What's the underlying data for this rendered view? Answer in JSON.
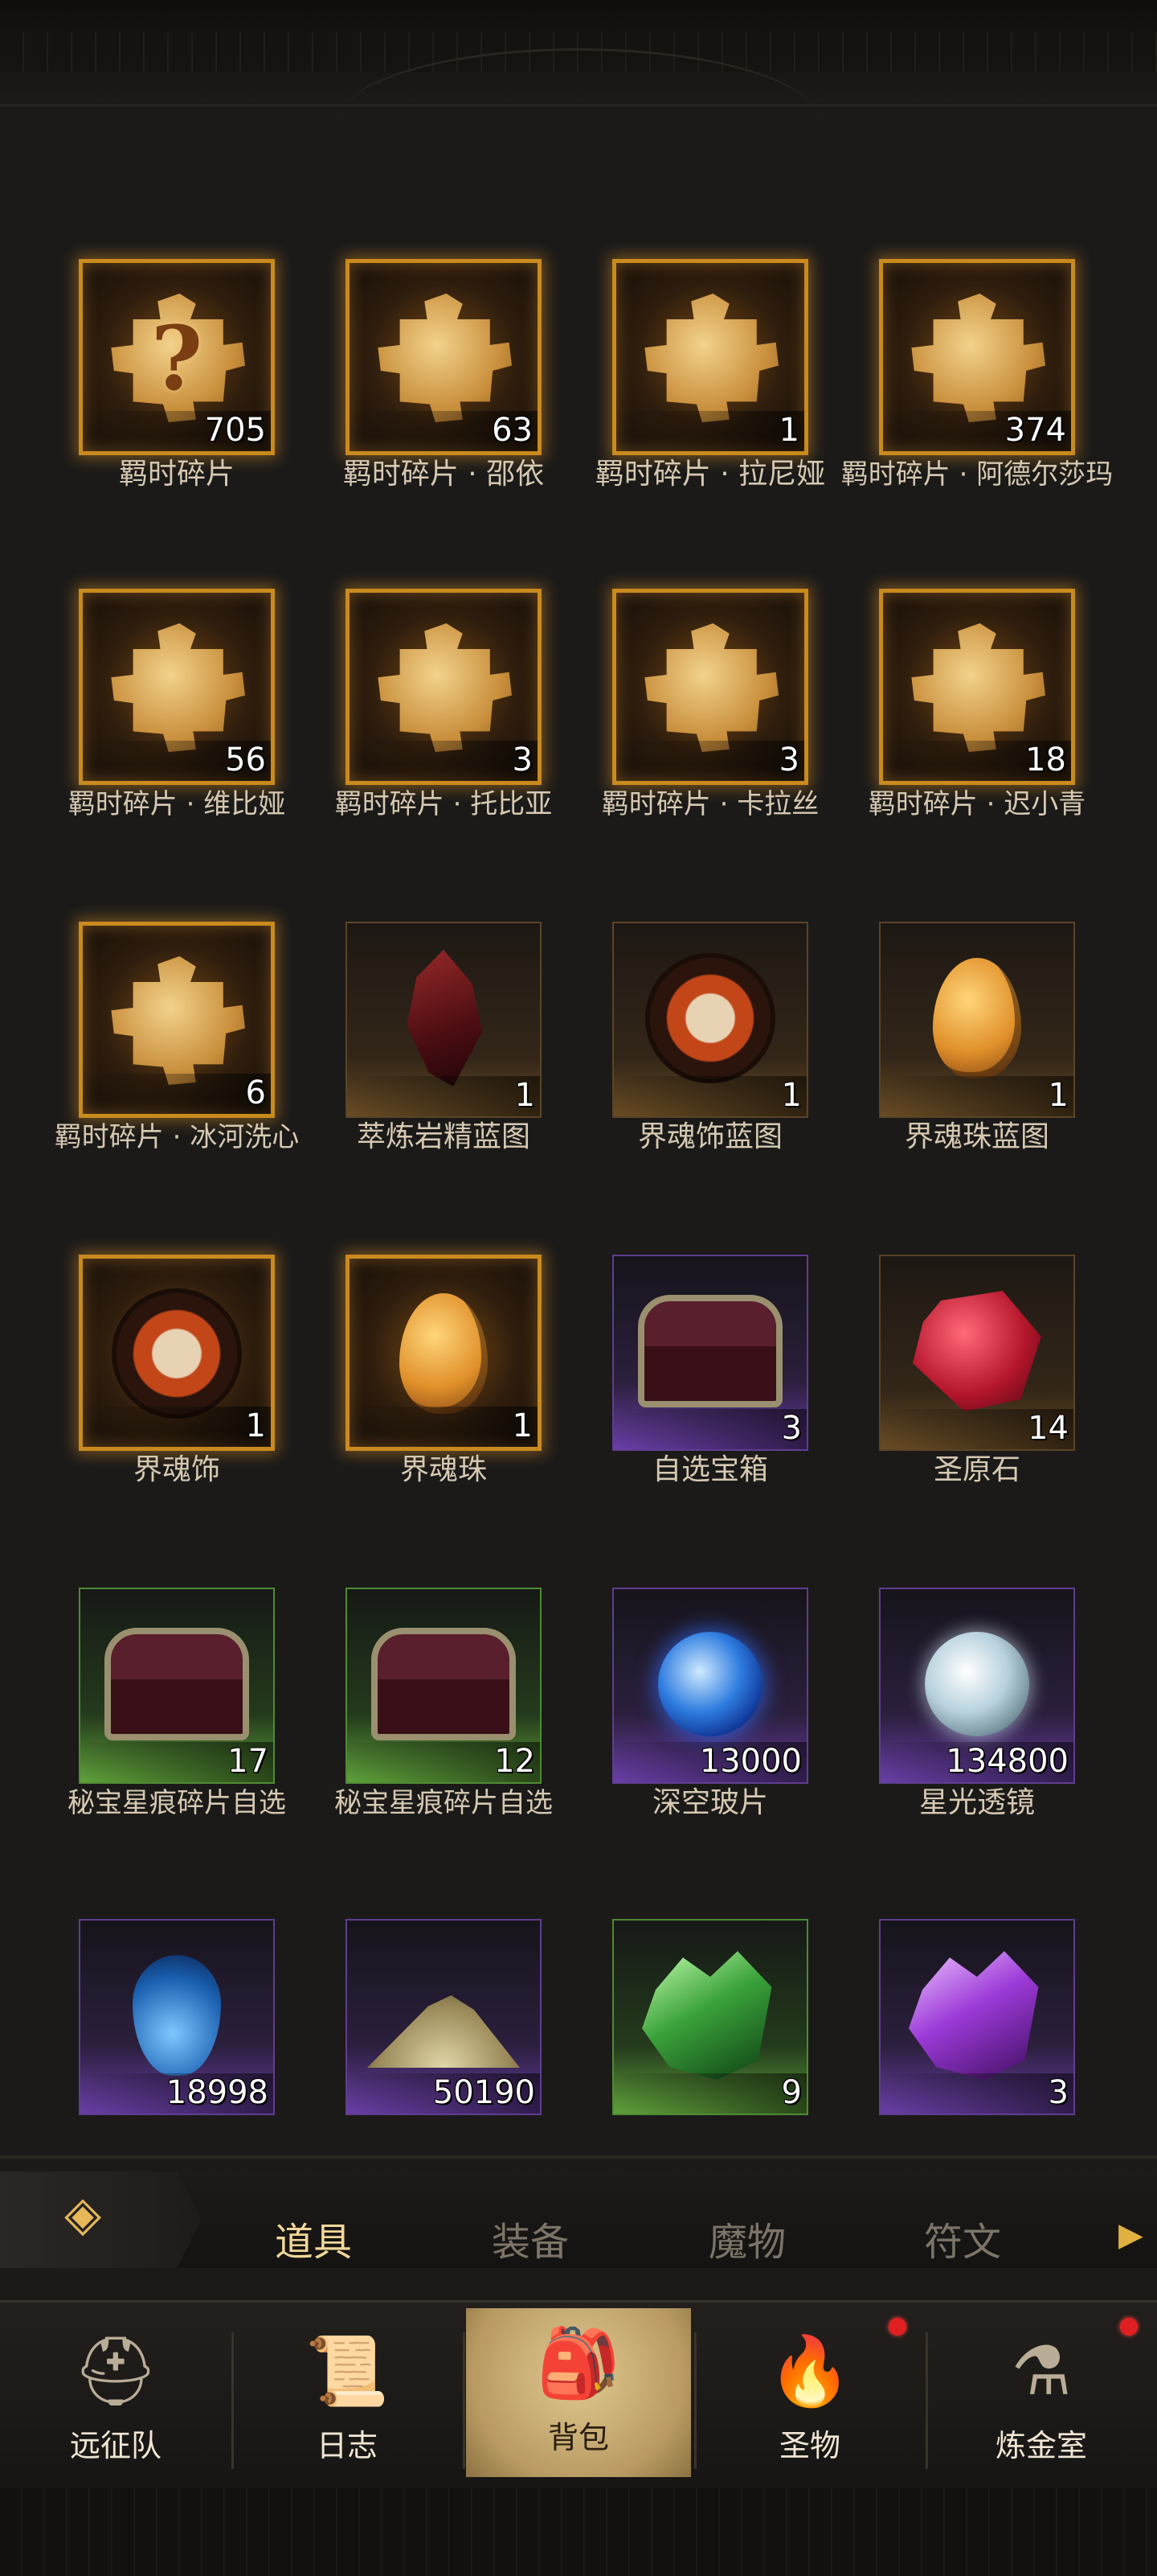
{
  "items": [
    {
      "label": "羁时碎片",
      "count": "705",
      "icon": "puzzle-question-icon",
      "frame": "gold"
    },
    {
      "label": "羁时碎片 · 邵依",
      "count": "63",
      "icon": "puzzle-portrait-icon",
      "frame": "gold"
    },
    {
      "label": "羁时碎片 · 拉尼娅",
      "count": "1",
      "icon": "puzzle-portrait-icon",
      "frame": "gold"
    },
    {
      "label": "羁时碎片 · 阿德尔莎玛",
      "count": "374",
      "icon": "puzzle-portrait-icon",
      "frame": "gold"
    },
    {
      "label": "羁时碎片 · 维比娅",
      "count": "56",
      "icon": "puzzle-portrait-icon",
      "frame": "gold"
    },
    {
      "label": "羁时碎片 · 托比亚",
      "count": "3",
      "icon": "puzzle-portrait-icon",
      "frame": "gold"
    },
    {
      "label": "羁时碎片 · 卡拉丝",
      "count": "3",
      "icon": "puzzle-portrait-icon",
      "frame": "gold"
    },
    {
      "label": "羁时碎片 · 迟小青",
      "count": "18",
      "icon": "puzzle-portrait-icon",
      "frame": "gold"
    },
    {
      "label": "羁时碎片 · 冰河洗心",
      "count": "6",
      "icon": "puzzle-portrait-icon",
      "frame": "gold"
    },
    {
      "label": "萃炼岩精蓝图",
      "count": "1",
      "icon": "red-crystal-icon",
      "frame": "brown"
    },
    {
      "label": "界魂饰蓝图",
      "count": "1",
      "icon": "sun-mask-icon",
      "frame": "brown"
    },
    {
      "label": "界魂珠蓝图",
      "count": "1",
      "icon": "amber-egg-icon",
      "frame": "brown"
    },
    {
      "label": "界魂饰",
      "count": "1",
      "icon": "sun-mask-icon",
      "frame": "gold"
    },
    {
      "label": "界魂珠",
      "count": "1",
      "icon": "amber-egg-icon",
      "frame": "gold"
    },
    {
      "label": "自选宝箱",
      "count": "3",
      "icon": "treasure-chest-icon",
      "frame": "purple"
    },
    {
      "label": "圣原石",
      "count": "14",
      "icon": "red-gem-icon",
      "frame": "brown"
    },
    {
      "label": "秘宝星痕碎片自选",
      "count": "17",
      "icon": "treasure-chest-icon",
      "frame": "green"
    },
    {
      "label": "秘宝星痕碎片自选",
      "count": "12",
      "icon": "treasure-chest-icon",
      "frame": "green"
    },
    {
      "label": "深空玻片",
      "count": "13000",
      "icon": "blue-orb-icon",
      "frame": "purple"
    },
    {
      "label": "星光透镜",
      "count": "134800",
      "icon": "white-orb-icon",
      "frame": "purple"
    },
    {
      "label": "",
      "count": "18998",
      "icon": "potion-icon",
      "frame": "purple"
    },
    {
      "label": "",
      "count": "50190",
      "icon": "sand-pile-icon",
      "frame": "purple"
    },
    {
      "label": "",
      "count": "9",
      "icon": "green-shards-icon",
      "frame": "green"
    },
    {
      "label": "",
      "count": "3",
      "icon": "purple-shards-icon",
      "frame": "purple"
    }
  ],
  "tabs": {
    "items": "道具",
    "equipment": "装备",
    "monsters": "魔物",
    "runes": "符文",
    "active": "道具"
  },
  "nav": {
    "expedition": "远征队",
    "journal": "日志",
    "backpack": "背包",
    "relics": "圣物",
    "alchemy": "炼金室",
    "active": "背包"
  },
  "colors": {
    "gold_frame": "#c98a1e",
    "purple_frame": "#6a3fa8",
    "green_frame": "#5fa23a",
    "active_tab": "#f1d79a",
    "notification": "#e02020"
  }
}
